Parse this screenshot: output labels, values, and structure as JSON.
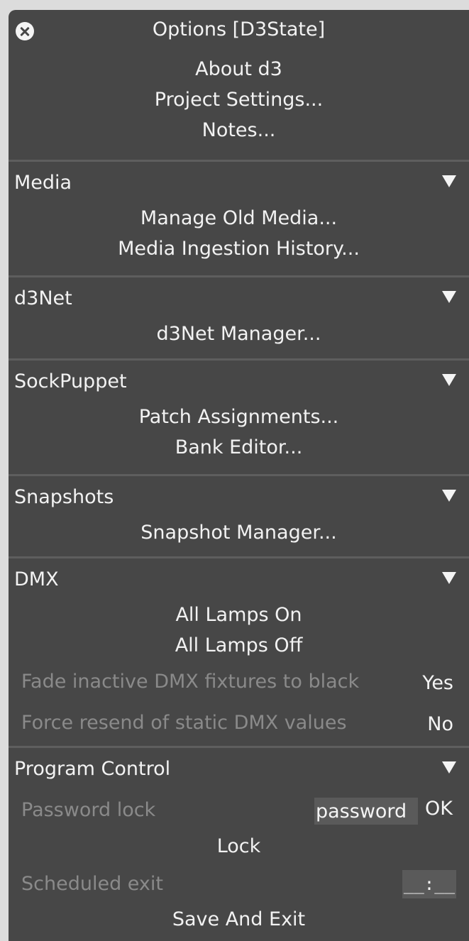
{
  "window": {
    "title": "Options [D3State]"
  },
  "top_items": [
    "About d3",
    "Project Settings...",
    "Notes..."
  ],
  "sections": {
    "media": {
      "label": "Media",
      "items": [
        "Manage Old Media...",
        "Media Ingestion History..."
      ]
    },
    "d3net": {
      "label": "d3Net",
      "items": [
        "d3Net Manager..."
      ]
    },
    "sockpuppet": {
      "label": "SockPuppet",
      "items": [
        "Patch Assignments...",
        "Bank Editor..."
      ]
    },
    "snapshots": {
      "label": "Snapshots",
      "items": [
        "Snapshot Manager..."
      ]
    },
    "dmx": {
      "label": "DMX",
      "items": [
        "All Lamps On",
        "All Lamps Off"
      ],
      "options": [
        {
          "label": "Fade inactive DMX fixtures to black",
          "value": "Yes"
        },
        {
          "label": "Force resend of static DMX values",
          "value": "No"
        }
      ]
    },
    "program_control": {
      "label": "Program Control",
      "password_label": "Password lock",
      "password_value": "password",
      "ok_label": "OK",
      "lock_label": "Lock",
      "scheduled_label": "Scheduled exit",
      "scheduled_value": "__:__",
      "save_exit_label": "Save And Exit"
    }
  },
  "icons": {
    "close": "close-icon",
    "collapse": "triangle-down-icon"
  },
  "colors": {
    "panel_bg": "#474747",
    "text": "#f2f2f2",
    "disabled_text": "#8a8a8a",
    "divider": "#5e5e5e"
  }
}
